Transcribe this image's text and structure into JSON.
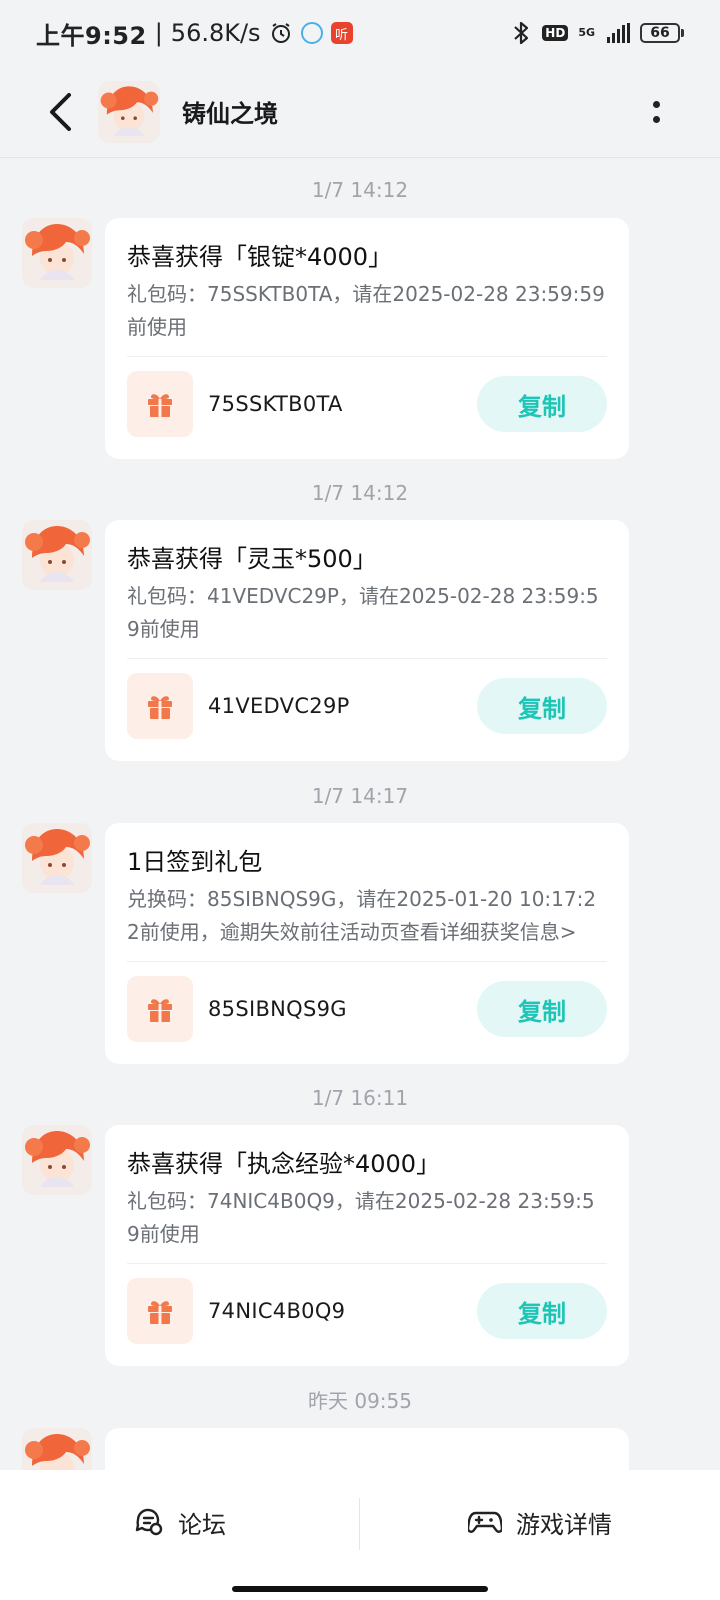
{
  "status_bar": {
    "time": "上午9:52",
    "net_speed": "56.8K/s",
    "app_badge": "听",
    "hd": "HD",
    "network": "5G",
    "battery": "66"
  },
  "header": {
    "title": "铸仙之境"
  },
  "messages": [
    {
      "time": "1/7  14:12",
      "title": "恭喜获得「银锭*4000」",
      "desc": "礼包码：75SSKTB0TA，请在2025-02-28 23:59:59前使用",
      "code": "75SSKTB0TA",
      "copy_label": "复制"
    },
    {
      "time": "1/7  14:12",
      "title": "恭喜获得「灵玉*500」",
      "desc": "礼包码：41VEDVC29P，请在2025-02-28 23:59:59前使用",
      "code": "41VEDVC29P",
      "copy_label": "复制"
    },
    {
      "time": "1/7  14:17",
      "title": "1日签到礼包",
      "desc": "兑换码：85SIBNQS9G，请在2025-01-20 10:17:22前使用，逾期失效前往活动页查看详细获奖信息>",
      "code": "85SIBNQS9G",
      "copy_label": "复制"
    },
    {
      "time": "1/7  16:11",
      "title": "恭喜获得「执念经验*4000」",
      "desc": "礼包码：74NIC4B0Q9，请在2025-02-28 23:59:59前使用",
      "code": "74NIC4B0Q9",
      "copy_label": "复制"
    },
    {
      "time": "昨天  09:55"
    }
  ],
  "bottom_bar": {
    "forum_label": "论坛",
    "game_details_label": "游戏详情"
  },
  "colors": {
    "background": "#f2f3f5",
    "accent": "#1ec4b6",
    "gift_icon": "#f0784a"
  }
}
